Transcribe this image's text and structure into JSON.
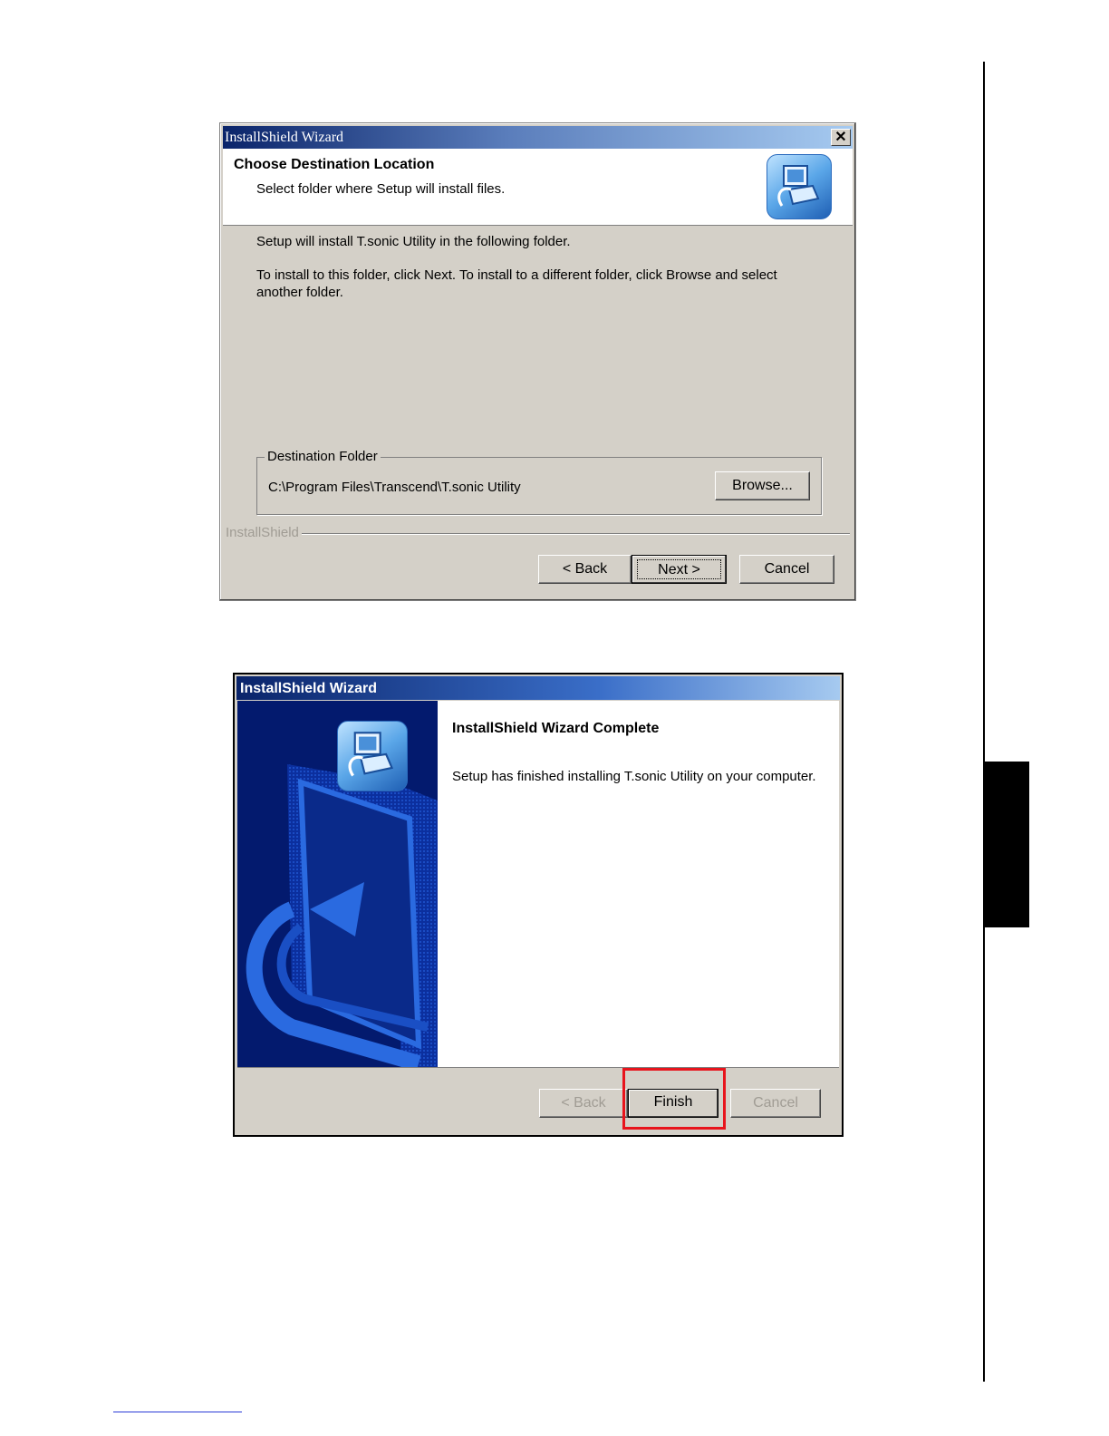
{
  "dialog1": {
    "title": "InstallShield Wizard",
    "close_glyph": "✕",
    "heading": "Choose Destination Location",
    "subheading": "Select folder where Setup will install files.",
    "text1": "Setup will install T.sonic Utility in the following folder.",
    "text2": "To install to this folder, click Next. To install to a different folder, click Browse and select another folder.",
    "group_label": "Destination Folder",
    "path": "C:\\Program Files\\Transcend\\T.sonic Utility",
    "browse_label": "Browse...",
    "brand": "InstallShield",
    "back_label": "< Back",
    "next_label": "Next >",
    "cancel_label": "Cancel"
  },
  "dialog2": {
    "title": "InstallShield Wizard",
    "heading": "InstallShield Wizard Complete",
    "text": "Setup has finished installing T.sonic Utility on your computer.",
    "back_label": "< Back",
    "finish_label": "Finish",
    "cancel_label": "Cancel"
  },
  "colors": {
    "highlight": "#e8141c",
    "title_gradient_start": "#0a246a",
    "panel_blue": "#031a6e"
  }
}
